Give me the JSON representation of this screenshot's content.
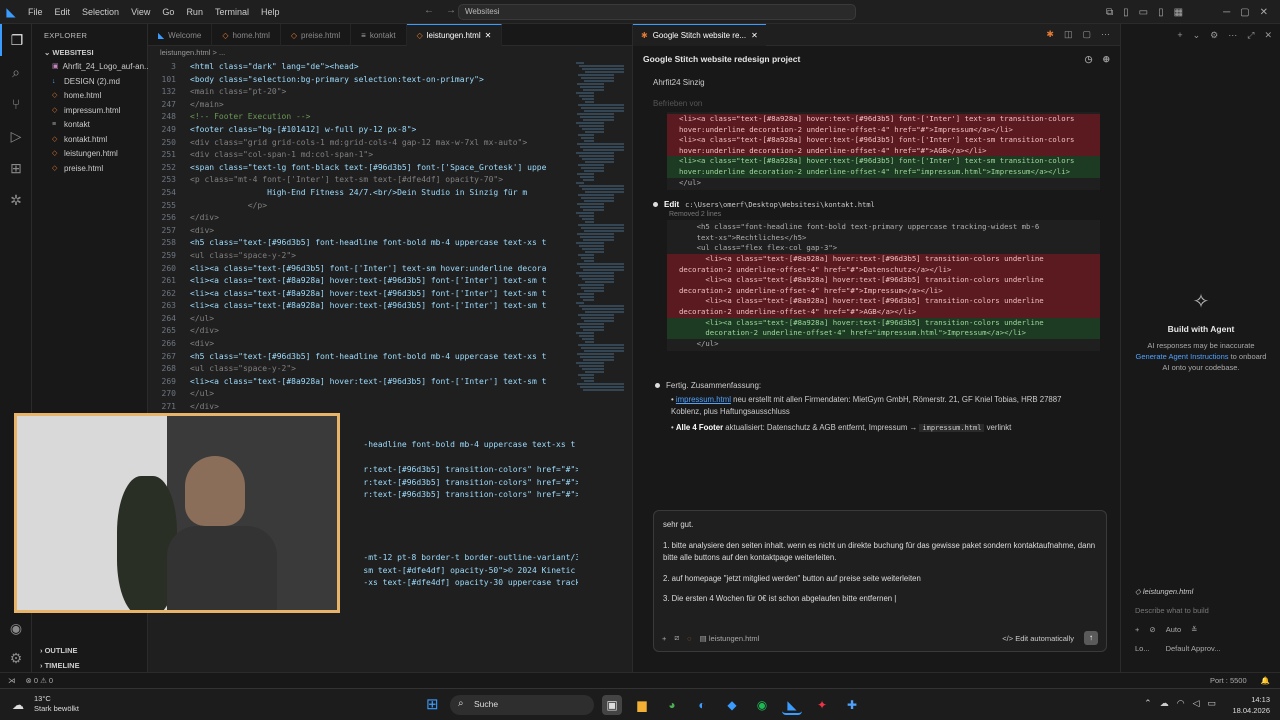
{
  "titlebar": {
    "menu": [
      "File",
      "Edit",
      "Selection",
      "View",
      "Go",
      "Run",
      "Terminal",
      "Help"
    ],
    "search": "Websitesi"
  },
  "sidebar": {
    "header": "EXPLORER",
    "folder": "WEBSITESI",
    "files": [
      "Ahrfit_24_Logo_auf-an...",
      "DESIGN (2).md",
      "home.html",
      "impressum.html",
      "kontakt",
      "kontakt.html",
      "leistungen.html",
      "preise.html"
    ],
    "outline": "OUTLINE",
    "timeline": "TIMELINE"
  },
  "editor": {
    "tabs": [
      "Welcome",
      "home.html",
      "preise.html",
      "kontakt",
      "leistungen.html"
    ],
    "breadcrumb": "leistungen.html > ...",
    "lines": [
      {
        "n": "3",
        "t": "<html class=\"dark\" lang=\"de\"><head>"
      },
      {
        "n": "101",
        "t": "<body class=\"selection:bg-primary selection:text-on-primary\">"
      },
      {
        "n": "132",
        "t": "<main class=\"pt-20\">"
      },
      {
        "n": "247",
        "t": "</main>"
      },
      {
        "n": "248",
        "t": "<!-- Footer Execution -->"
      },
      {
        "n": "249",
        "t": "<footer class=\"bg-[#101412] w-full py-12 px-8\">"
      },
      {
        "n": "250",
        "t": "<div class=\"grid grid-cols-1 md:grid-cols-4 gap-12 max-w-7xl mx-auto\">"
      },
      {
        "n": "251",
        "t": "<div class=\"col-span-1 md:col-span-1\">"
      },
      {
        "n": "252",
        "t": "<span class=\"text-lg font-black text-[#96d3b5] font-['Space_Grotesk'] uppe"
      },
      {
        "n": "253",
        "t": "<p class=\"mt-4 font-['Inter'] text-sm text-[#dfe4df] opacity-70\">"
      },
      {
        "n": "254",
        "t": "                High-End Fitness 24/7.<br/>Dein Studio in Sinzig für m"
      },
      {
        "n": "255",
        "t": "            </p>"
      },
      {
        "n": "256",
        "t": "</div>"
      },
      {
        "n": "257",
        "t": "<div>"
      },
      {
        "n": "258",
        "t": "<h5 class=\"text-[#96d3b5] font-headline font-bold mb-4 uppercase text-xs t"
      },
      {
        "n": "259",
        "t": "<ul class=\"space-y-2\">"
      },
      {
        "n": "260",
        "t": "<li><a class=\"text-[#96d3b5] font-['Inter'] text-sm hover:underline decora"
      },
      {
        "n": "261",
        "t": "<li><a class=\"text-[#8a928a] hover:text-[#96d3b5] font-['Inter'] text-sm t"
      },
      {
        "n": "262",
        "t": "<li><a class=\"text-[#8a928a] hover:text-[#96d3b5] font-['Inter'] text-sm t"
      },
      {
        "n": "263",
        "t": "<li><a class=\"text-[#8a928a] hover:text-[#96d3b5] font-['Inter'] text-sm t"
      },
      {
        "n": "264",
        "t": "</ul>"
      },
      {
        "n": "265",
        "t": "</div>"
      },
      {
        "n": "266",
        "t": "<div>"
      },
      {
        "n": "267",
        "t": "<h5 class=\"text-[#96d3b5] font-headline font-bold mb-4 uppercase text-xs t"
      },
      {
        "n": "268",
        "t": "<ul class=\"space-y-2\">"
      },
      {
        "n": "269",
        "t": "<li><a class=\"text-[#8a928a] hover:text-[#96d3b5] font-['Inter'] text-sm t"
      },
      {
        "n": "270",
        "t": "</ul>"
      },
      {
        "n": "271",
        "t": "</div>"
      },
      {
        "n": "",
        "t": ""
      },
      {
        "n": "",
        "t": ""
      },
      {
        "n": "",
        "t": "                                    -headline font-bold mb-4 uppercase text-xs t"
      },
      {
        "n": "",
        "t": ""
      },
      {
        "n": "",
        "t": "                                    r:text-[#96d3b5] transition-colors\" href=\"#\">"
      },
      {
        "n": "",
        "t": "                                    r:text-[#96d3b5] transition-colors\" href=\"#\">"
      },
      {
        "n": "",
        "t": "                                    r:text-[#96d3b5] transition-colors\" href=\"#\">"
      },
      {
        "n": "",
        "t": ""
      },
      {
        "n": "",
        "t": ""
      },
      {
        "n": "",
        "t": ""
      },
      {
        "n": "",
        "t": ""
      },
      {
        "n": "",
        "t": "                                    -mt-12 pt-8 border-t border-outline-variant/3"
      },
      {
        "n": "",
        "t": "                                    sm text-[#dfe4df] opacity-50\">© 2024 Kinetic"
      },
      {
        "n": "",
        "t": "                                    -xs text-[#dfe4df] opacity-30 uppercase track"
      }
    ]
  },
  "chat": {
    "tab_label": "Google Stitch website re...",
    "title": "Google Stitch website redesign project",
    "first_line": "Ahrfit24 Sinzig",
    "faded": "Befrieben von",
    "diff1": [
      {
        "k": "del",
        "t": "<li><a class=\"text-[#8a928a] hover:text-[#96d3b5] font-['Inter'] text-sm transition-colors"
      },
      {
        "k": "del",
        "t": "hover:underline decoration-2 underline-offset-4\" href=\"#\">Impressum</a></li>"
      },
      {
        "k": "del",
        "t": "<li><a class=\"text-[#8a928a] hover:text-[#96d3b5] font-['Inter'] text-sm transition-colors"
      },
      {
        "k": "del",
        "t": "hover:underline decoration-2 underline-offset-4\" href=\"#\">AGB</a></li>"
      },
      {
        "k": "add",
        "t": "<li><a class=\"text-[#8a928a] hover:text-[#96d3b5] font-['Inter'] text-sm transition-colors"
      },
      {
        "k": "add",
        "t": "hover:underline decoration-2 underline-offset-4\" href=\"impressum.html\">Impressum</a></li>"
      },
      {
        "k": "ctx",
        "t": "</ul>"
      }
    ],
    "edit_label": "Edit",
    "edit_path": "c:\\Users\\omerf\\Desktop\\Websitesi\\kontakt.html",
    "removed": "Removed 2 lines",
    "diff2": [
      {
        "k": "ctx",
        "t": "    <h5 class=\"font-headline font-bold text-primary uppercase tracking-widest mb-6"
      },
      {
        "k": "ctx",
        "t": "    text-xs\">Rechtliches</h5>"
      },
      {
        "k": "ctx",
        "t": "    <ul class=\"flex flex-col gap-3\">"
      },
      {
        "k": "del",
        "t": "      <li><a class=\"text-[#8a928a] hover:text-[#96d3b5] transition-colors underline"
      },
      {
        "k": "del",
        "t": "decoration-2 underline-offset-4\" href=\"#\">Datenschutz</a></li>"
      },
      {
        "k": "del",
        "t": "      <li><a class=\"text-[#8a928a] hover:text-[#96d3b5] transition-colors underline"
      },
      {
        "k": "del",
        "t": "decoration-2 underline-offset-4\" href=\"#\">Impressum</a></li>"
      },
      {
        "k": "del",
        "t": "      <li><a class=\"text-[#8a928a] hover:text-[#96d3b5] transition-colors underline"
      },
      {
        "k": "del",
        "t": "decoration-2 underline-offset-4\" href=\"#\">AGB</a></li>"
      },
      {
        "k": "add",
        "t": "      <li><a class=\"text-[#8a928a] hover:text-[#96d3b5] transition-colors underline"
      },
      {
        "k": "add",
        "t": "      decoration-2 underline-offset-4\" href=\"impressum.html\">Impressum</a></li>"
      },
      {
        "k": "ctx",
        "t": "    </ul>"
      }
    ],
    "done_label": "Fertig. Zusammenfassung:",
    "summary1_link": "impressum.html",
    "summary1_rest": " neu erstellt mit allen Firmendaten: MietGym GmbH, Römerstr. 21, GF Kniel Tobias, HRB 27887 Koblenz, plus Haftungsausschluss",
    "summary2_bold": "Alle 4 Footer",
    "summary2_rest": " aktualisiert: Datenschutz & AGB entfernt, Impressum → ",
    "summary2_code": "impressum.html",
    "summary2_end": " verlinkt",
    "input": {
      "l1": "sehr gut.",
      "l2": "1. bitte analysiere den seiten inhalt. wenn es nicht un direkte buchung für das gewisse paket sondern kontaktaufnahme, dann bitte alle buttons auf den kontaktpage weiterleiten.",
      "l3": "2. auf homepage \"jetzt mitglied werden\" button auf preise seite weiterleiten",
      "l4": "3. Die ersten 4 Wochen für 0€ ist schon abgelaufen bitte entfernen |",
      "file_chip": "leistungen.html",
      "mode": "Edit automatically"
    }
  },
  "agent": {
    "title": "Build with Agent",
    "desc1": "AI responses may be inaccurate",
    "link": "Generate Agent Instructions",
    "desc2": "to onboard AI onto your codebase.",
    "file": "leistungen.html",
    "placeholder": "Describe what to build",
    "auto": "Auto",
    "local": "Lo...",
    "approvals": "Default Approv..."
  },
  "status": {
    "left": "⊗ 0  ⚠ 0",
    "port": "Port : 5500"
  },
  "taskbar": {
    "temp": "13°C",
    "weather": "Stark bewölkt",
    "search": "Suche",
    "time": "14:13",
    "date": "18.04.2026"
  }
}
